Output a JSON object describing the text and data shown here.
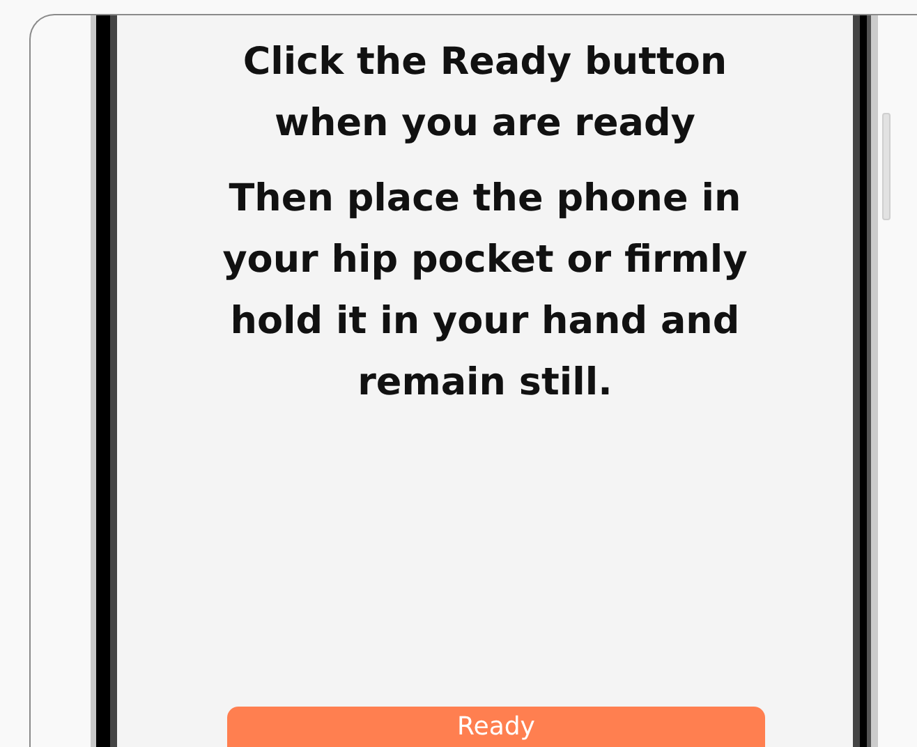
{
  "screen": {
    "instruction": "Click the Ready button when you are ready",
    "detail": "Then place the phone in your hip pocket or firmly hold it in your hand and remain still."
  },
  "ready_button": {
    "label": "Ready"
  }
}
